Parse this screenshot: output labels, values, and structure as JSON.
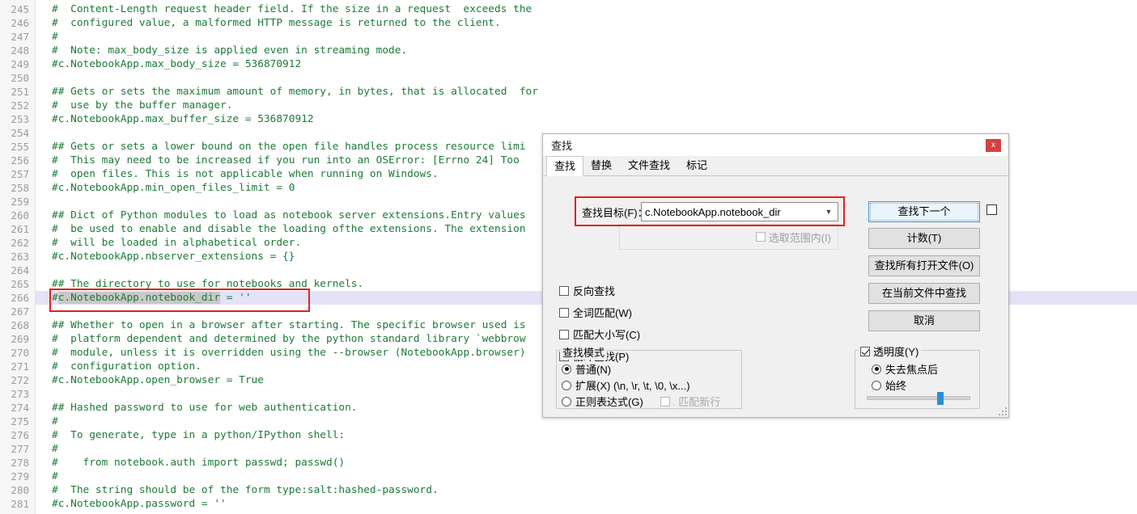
{
  "editor": {
    "first_line_number": 245,
    "current_line_number": 266,
    "lines": [
      {
        "n": 245,
        "text": "#  Content-Length request header field. If the size in a request  exceeds the"
      },
      {
        "n": 246,
        "text": "#  configured value, a malformed HTTP message is returned to the client."
      },
      {
        "n": 247,
        "text": "#"
      },
      {
        "n": 248,
        "text": "#  Note: max_body_size is applied even in streaming mode."
      },
      {
        "n": 249,
        "text": "#c.NotebookApp.max_body_size = 536870912"
      },
      {
        "n": 250,
        "text": ""
      },
      {
        "n": 251,
        "text": "## Gets or sets the maximum amount of memory, in bytes, that is allocated  for"
      },
      {
        "n": 252,
        "text": "#  use by the buffer manager."
      },
      {
        "n": 253,
        "text": "#c.NotebookApp.max_buffer_size = 536870912"
      },
      {
        "n": 254,
        "text": ""
      },
      {
        "n": 255,
        "text": "## Gets or sets a lower bound on the open file handles process resource limi"
      },
      {
        "n": 256,
        "text": "#  This may need to be increased if you run into an OSError: [Errno 24] Too"
      },
      {
        "n": 257,
        "text": "#  open files. This is not applicable when running on Windows."
      },
      {
        "n": 258,
        "text": "#c.NotebookApp.min_open_files_limit = 0"
      },
      {
        "n": 259,
        "text": ""
      },
      {
        "n": 260,
        "text": "## Dict of Python modules to load as notebook server extensions.Entry values"
      },
      {
        "n": 261,
        "text": "#  be used to enable and disable the loading ofthe extensions. The extension"
      },
      {
        "n": 262,
        "text": "#  will be loaded in alphabetical order."
      },
      {
        "n": 263,
        "text": "#c.NotebookApp.nbserver_extensions = {}"
      },
      {
        "n": 264,
        "text": ""
      },
      {
        "n": 265,
        "text": "## The directory to use for notebooks and kernels."
      },
      {
        "n": 266,
        "text": "#c.NotebookApp.notebook_dir = ''",
        "selection": "c.NotebookApp.notebook_dir",
        "current": true
      },
      {
        "n": 267,
        "text": ""
      },
      {
        "n": 268,
        "text": "## Whether to open in a browser after starting. The specific browser used is"
      },
      {
        "n": 269,
        "text": "#  platform dependent and determined by the python standard library `webbrow"
      },
      {
        "n": 270,
        "text": "#  module, unless it is overridden using the --browser (NotebookApp.browser)"
      },
      {
        "n": 271,
        "text": "#  configuration option."
      },
      {
        "n": 272,
        "text": "#c.NotebookApp.open_browser = True"
      },
      {
        "n": 273,
        "text": ""
      },
      {
        "n": 274,
        "text": "## Hashed password to use for web authentication."
      },
      {
        "n": 275,
        "text": "#"
      },
      {
        "n": 276,
        "text": "#  To generate, type in a python/IPython shell:"
      },
      {
        "n": 277,
        "text": "#"
      },
      {
        "n": 278,
        "text": "#    from notebook.auth import passwd; passwd()"
      },
      {
        "n": 279,
        "text": "#"
      },
      {
        "n": 280,
        "text": "#  The string should be of the form type:salt:hashed-password."
      },
      {
        "n": 281,
        "text": "#c.NotebookApp.password = ''"
      }
    ],
    "colors": {
      "comment_green": "#1d7a38",
      "current_line_band": "#e4e2f7",
      "selection_gray": "#c8c8c8",
      "gutter_bg": "#f6f6f6",
      "annotation_red": "#e02020"
    }
  },
  "dialog": {
    "title": "查找",
    "close_label": "x",
    "tabs": [
      {
        "label": "查找",
        "active": true
      },
      {
        "label": "替换",
        "active": false
      },
      {
        "label": "文件查找",
        "active": false
      },
      {
        "label": "标记",
        "active": false
      }
    ],
    "search": {
      "label": "查找目标(F)：",
      "value": "c.NotebookApp.notebook_dir",
      "placeholder": "",
      "dropdown_icon": "chevron-down-icon"
    },
    "scope": {
      "label": "选取范围内(I)",
      "checked": false,
      "disabled": true
    },
    "options": [
      {
        "label": "反向查找",
        "checked": false
      },
      {
        "label": "全词匹配(W)",
        "checked": false
      },
      {
        "label": "匹配大小写(C)",
        "checked": false
      },
      {
        "label": "循环查找(P)",
        "checked": true
      }
    ],
    "mode_group": {
      "legend": "查找模式",
      "items": [
        {
          "label": "普通(N)",
          "checked": true
        },
        {
          "label": "扩展(X) (\\n, \\r, \\t, \\0, \\x...)",
          "checked": false
        },
        {
          "label": "正则表达式(G)",
          "checked": false
        }
      ],
      "newline_label": ". 匹配新行",
      "newline_checked": false,
      "newline_disabled": true
    },
    "buttons": [
      {
        "label": "查找下一个",
        "default": true
      },
      {
        "label": "计数(T)",
        "default": false
      },
      {
        "label": "查找所有打开文件(O)",
        "default": false
      },
      {
        "label": "在当前文件中查找",
        "default": false
      },
      {
        "label": "取消",
        "default": false
      }
    ],
    "wrap_checkbox": {
      "label": "",
      "checked": false
    },
    "transparency": {
      "label": "透明度(Y)",
      "checked": true,
      "items": [
        {
          "label": "失去焦点后",
          "checked": true
        },
        {
          "label": "始终",
          "checked": false
        }
      ],
      "slider_value": 66
    },
    "accent_color": "#4a90c4"
  }
}
